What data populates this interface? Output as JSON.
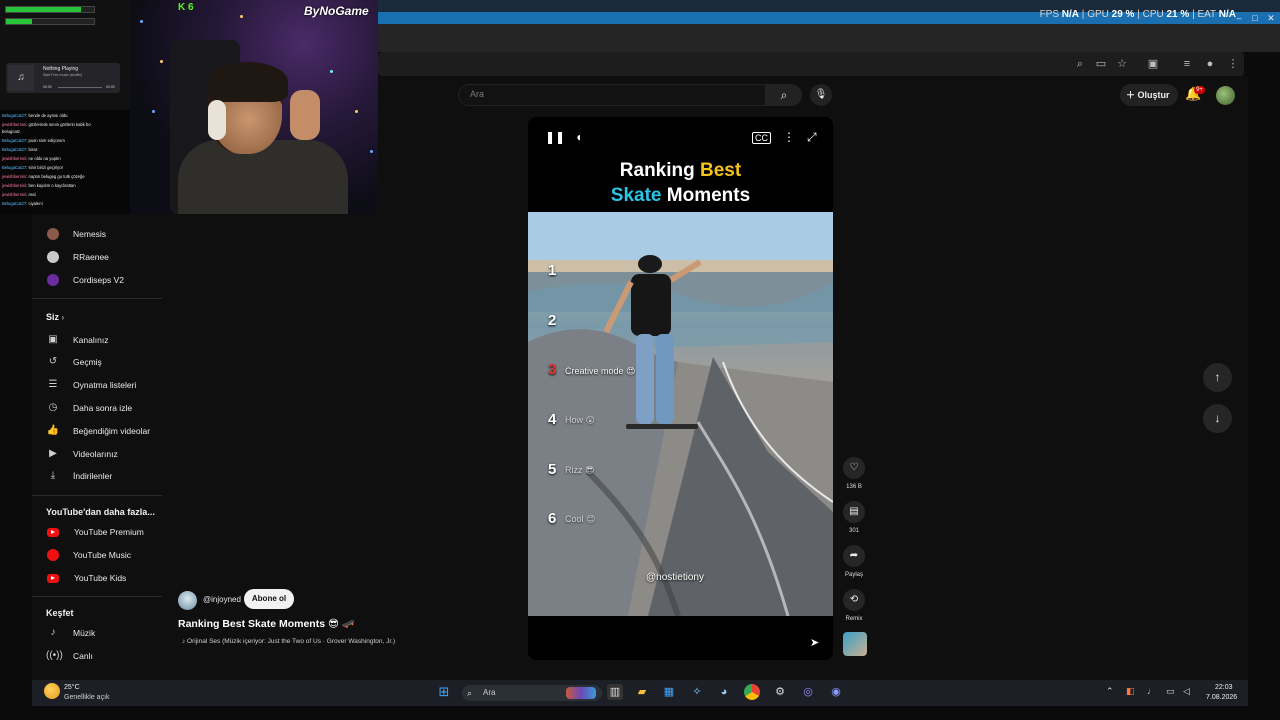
{
  "stats": {
    "fps_label": "FPS",
    "fps": "N/A",
    "gpu_label": "GPU",
    "gpu": "29 %",
    "cpu_label": "CPU",
    "cpu": "21 %",
    "eat_label": "EAT",
    "eat": "N/A"
  },
  "header": {
    "search_placeholder": "Ara",
    "create_label": "Oluştur",
    "notif_badge": "9+"
  },
  "sidebar": {
    "subscriptions": [
      "Nemesis",
      "RRaenee",
      "Cordiseps V2"
    ],
    "you_heading": "Siz",
    "you_items": [
      "Kanalınız",
      "Geçmiş",
      "Oynatma listeleri",
      "Daha sonra izle",
      "Beğendiğim videolar",
      "Videolarınız",
      "İndirilenler"
    ],
    "more_heading": "YouTube'dan daha fazla...",
    "more_items": [
      "YouTube Premium",
      "YouTube Music",
      "YouTube Kids"
    ],
    "explore_heading": "Keşfet",
    "explore_items": [
      "Müzik",
      "Canlı"
    ]
  },
  "short": {
    "title_line1_a": "Ranking ",
    "title_line1_b": "Best",
    "title_line2_a": "Skate",
    "title_line2_b": " Moments",
    "ranks": [
      {
        "num": "1",
        "label": ""
      },
      {
        "num": "2",
        "label": ""
      },
      {
        "num": "3",
        "label": "Creative mode 😍"
      },
      {
        "num": "4",
        "label": "How 😲"
      },
      {
        "num": "5",
        "label": "Rizz 😎"
      },
      {
        "num": "6",
        "label": "Cool 😊"
      }
    ],
    "watermark": "@nostietiony",
    "likes": "136 B",
    "comments": "301",
    "share_label": "Paylaş",
    "remix_label": "Remix",
    "channel": "@injoyned",
    "subscribe_label": "Abone ol",
    "video_title": "Ranking Best Skate Moments 😎 🛹",
    "audio": "♪ Orijinal Ses (Müzik içeriyor: Just the Two of Us · Grover Washington, Jr.)"
  },
  "taskbar": {
    "temp": "25°C",
    "weather": "Genellikle açık",
    "search_label": "Ara",
    "time": "22:03",
    "date": "7.08.2026"
  },
  "overlay": {
    "brand": "ByNoGame",
    "kick_count": "6",
    "music_title": "Nothing Playing",
    "music_sub": "Start Free music (shuffle)",
    "music_t0": "00:00",
    "music_t1": "00:00",
    "chat": [
      {
        "user": "BelugaCat27",
        "msg": "bende de aynısı oldu"
      },
      {
        "user": "jewishbernini",
        "msg": "gözlerinde senin gözlerin kabk bo"
      },
      {
        "user": "",
        "msg": "belugcatz"
      },
      {
        "user": "BelugaCat27",
        "msg": "pusn sinir ediyorum"
      },
      {
        "user": "BelugaCat27",
        "msg": "biraz"
      },
      {
        "user": "jewishbernini",
        "msg": "ne oldu na yaptın"
      },
      {
        "user": "BelugaCat27",
        "msg": "sinir birizi geçiriyor"
      },
      {
        "user": "jewishbernini",
        "msg": "naptın belugeg gu tutk çözeğe"
      },
      {
        "user": "jewishbernini",
        "msg": "ben kaydım o kaydırattan"
      },
      {
        "user": "jewishbernini",
        "msg": "real"
      },
      {
        "user": "BelugaCat27",
        "msg": "ciyalen!"
      }
    ]
  }
}
